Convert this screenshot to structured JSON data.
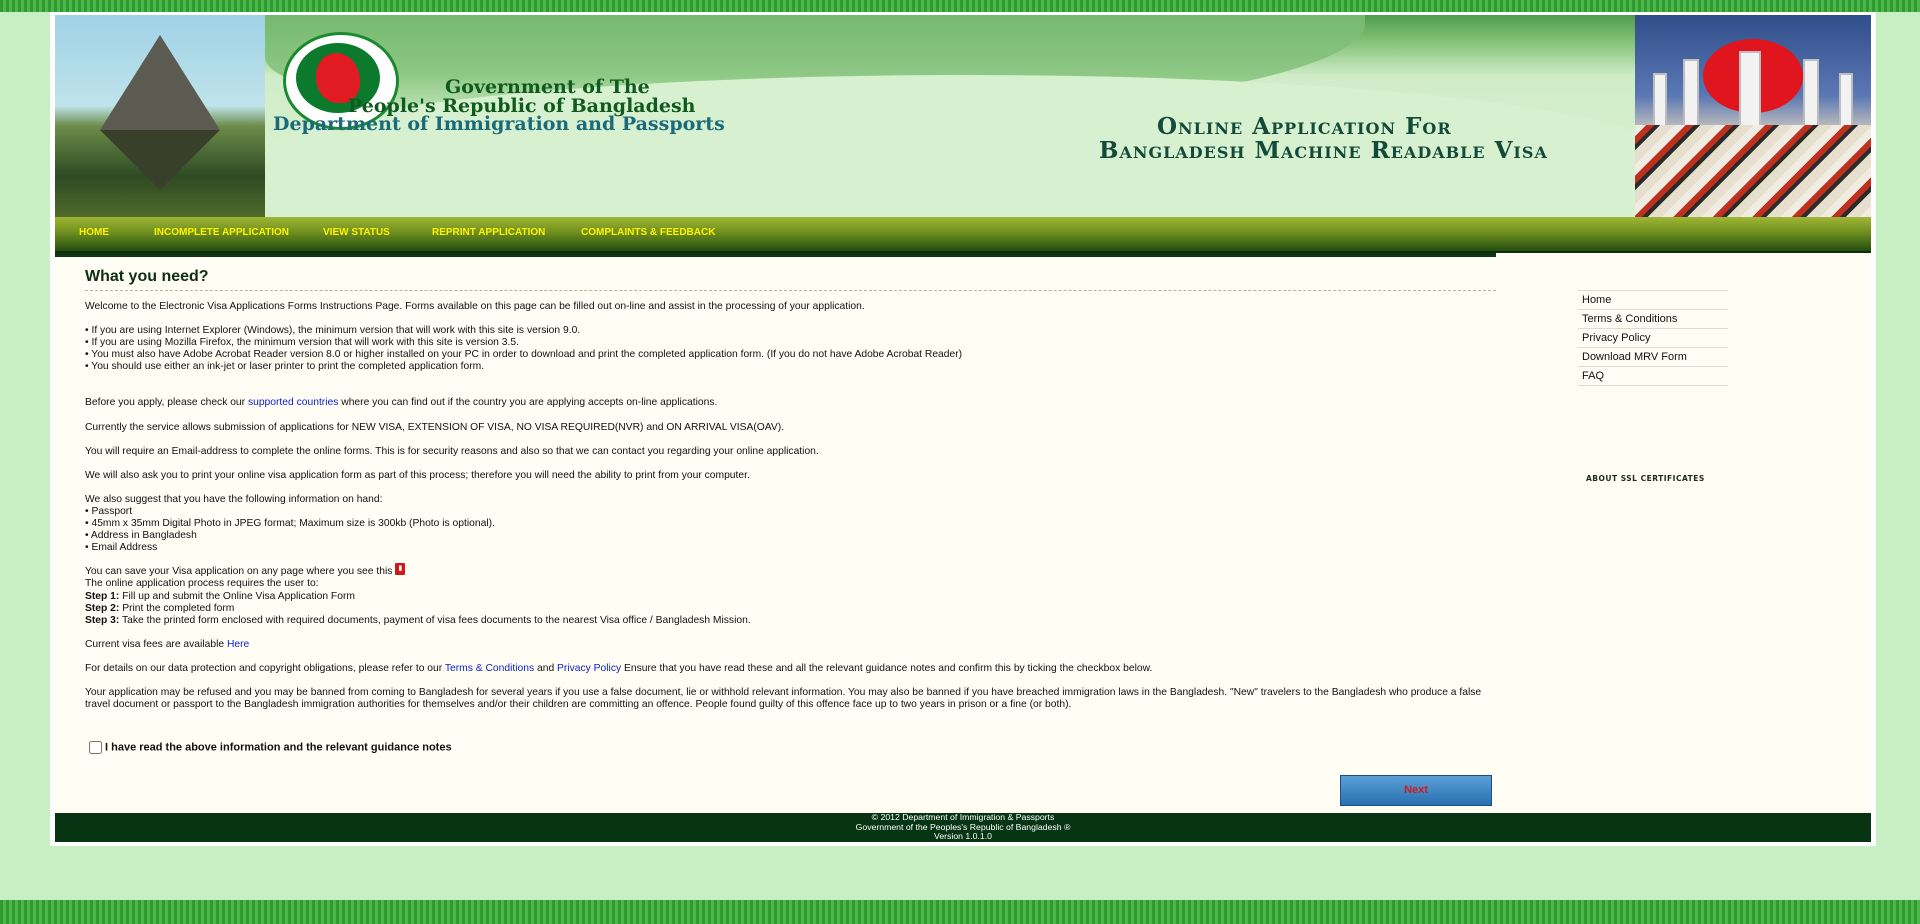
{
  "banner": {
    "gov_line1": "Government of The",
    "gov_line2": "People's Republic of Bangladesh",
    "gov_line3": "Department of Immigration and Passports",
    "app_line1": "Online Application For",
    "app_line2": "Bangladesh Machine Readable Visa"
  },
  "nav": {
    "home": "HOME",
    "incomplete": "INCOMPLETE APPLICATION",
    "status": "VIEW STATUS",
    "reprint": "REPRINT APPLICATION",
    "complaints": "COMPLAINTS & FEEDBACK"
  },
  "main": {
    "title": "What you need?",
    "welcome": "Welcome to the Electronic Visa Applications Forms Instructions Page. Forms available on this page can be filled out on-line and assist in the processing of your application.",
    "req1": "• If you are using Internet Explorer (Windows), the minimum version that will work with this site is version 9.0.",
    "req2": "• If you are using Mozilla Firefox, the minimum version that will work with this site is version 3.5.",
    "req3": "• You must also have Adobe Acrobat Reader version 8.0 or higher installed on your PC in order to download and print the completed application form. (If you do not have Adobe Acrobat Reader)",
    "req4": "• You should use either an ink-jet or laser printer to print the completed application form.",
    "before_pre": "Before you apply, please check our ",
    "before_link": "supported countries",
    "before_post": " where you can find out if the country you are applying accepts on-line applications.",
    "service": "Currently the service allows submission of applications for NEW VISA, EXTENSION OF VISA, NO VISA REQUIRED(NVR) and ON ARRIVAL VISA(OAV).",
    "email": "You will require an Email-address to complete the online forms. This is for security reasons and also so that we can contact you regarding your online application.",
    "print": "We will also ask you to print your online visa application form as part of this process; therefore you will need the ability to print from your computer.",
    "suggest": "We also suggest that you have the following information on hand:",
    "info1": "• Passport",
    "info2": "• 45mm x 35mm Digital Photo in JPEG format; Maximum size is 300kb (Photo is optional).",
    "info3": "• Address in Bangladesh",
    "info4": "• Email Address",
    "save": "You can save your Visa application on any page where you see this",
    "process": "The online application process requires the user to:",
    "step1_label": "Step 1:",
    "step1": " Fill up and submit the Online Visa Application Form",
    "step2_label": "Step 2:",
    "step2": " Print the completed form",
    "step3_label": "Step 3:",
    "step3": " Take the printed form enclosed with required documents, payment of visa fees documents to the nearest Visa office / Bangladesh Mission.",
    "fees_pre": "Current visa fees are available ",
    "fees_link": "Here",
    "details_pre": "For details on our data protection and copyright obligations, please refer to our ",
    "terms_link": "Terms & Conditions",
    "details_and": " and ",
    "privacy_link": "Privacy Policy",
    "details_post": " Ensure that you have read these and all the relevant guidance notes and confirm this by ticking the checkbox below.",
    "warning": "Your application may be refused and you may be banned from coming to Bangladesh for several years if you use a false document, lie or withhold relevant information. You may also be banned if you have breached immigration laws in the Bangladesh. \"New\" travelers to the Bangladesh who produce a false travel document or passport to the Bangladesh immigration authorities for themselves and/or their children are committing an offence. People found guilty of this offence face up to two years in prison or a fine (or both).",
    "confirm": "I have read the above information and the relevant guidance notes",
    "next": "Next"
  },
  "sidebar": {
    "items": [
      "Home",
      "Terms & Conditions",
      "Privacy Policy",
      "Download MRV Form",
      "FAQ"
    ],
    "ssl": "ABOUT SSL CERTIFICATES"
  },
  "footer": {
    "line1": "© 2012 Department of Immigration & Passports",
    "line2": "Government of the Peoples's Republic of Bangladesh ®",
    "line3": "Version 1.0.1.0"
  },
  "colors": {
    "nav_text": "#fff200",
    "link": "#1023c8",
    "footer_bg": "#073513",
    "next_text": "#d61b1b"
  }
}
